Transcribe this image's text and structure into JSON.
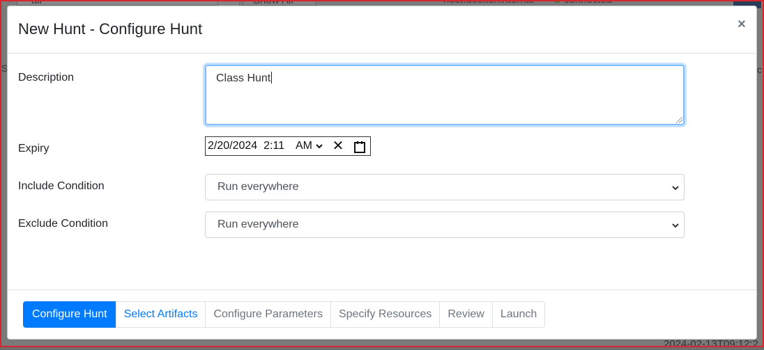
{
  "background": {
    "search_value": "all",
    "show_all_label": "Show All",
    "host_text": "host.docker.internal",
    "status_text": "connected",
    "timestamp_text": "2024-02-13T09:12:2"
  },
  "modal": {
    "title": "New Hunt - Configure Hunt",
    "close_symbol": "×",
    "description_label": "Description",
    "description_value": "Class Hunt",
    "expiry_label": "Expiry",
    "expiry_date": "2/20/2024",
    "expiry_time": "2:11",
    "expiry_ampm": "AM",
    "clear_symbol": "✕",
    "include_label": "Include Condition",
    "include_value": "Run everywhere",
    "exclude_label": "Exclude Condition",
    "exclude_value": "Run everywhere"
  },
  "wizard": {
    "steps": [
      {
        "label": "Configure Hunt",
        "state": "active"
      },
      {
        "label": "Select Artifacts",
        "state": "link"
      },
      {
        "label": "Configure Parameters",
        "state": "disabled"
      },
      {
        "label": "Specify Resources",
        "state": "disabled"
      },
      {
        "label": "Review",
        "state": "disabled"
      },
      {
        "label": "Launch",
        "state": "disabled"
      }
    ]
  },
  "colors": {
    "accent": "#007bff",
    "focus_border": "#80bdff",
    "frame_red": "#d9262c"
  },
  "icons": [
    "close-icon",
    "clear-icon",
    "calendar-icon",
    "chevron-down-icon"
  ]
}
